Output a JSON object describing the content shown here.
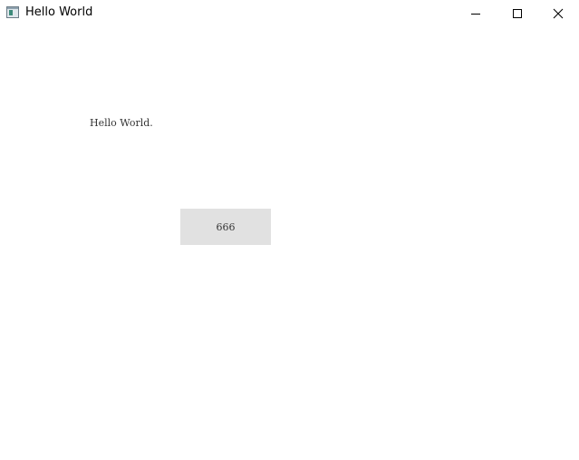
{
  "window": {
    "title": "Hello World",
    "controls": {
      "minimize_icon": "minimize-icon",
      "maximize_icon": "maximize-icon",
      "close_icon": "close-icon"
    }
  },
  "content": {
    "label_text": "Hello World.",
    "button_label": "666"
  },
  "colors": {
    "background": "#ffffff",
    "button_bg": "#e1e1e1",
    "text": "#333333"
  }
}
